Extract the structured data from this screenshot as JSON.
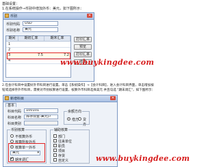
{
  "intro": {
    "heading": "基础设置：",
    "step1_text": "1.在系统操作→币别中增加外币：美元，如下图所示：",
    "step2_line1": "2.在会计科目中设置好外币科目进行设置。单击【系统操作】→【会计科目】，进入会计科目界面，单击增加按",
    "step2_line2": "钮或选择存外币科目，需要对币别核算进行设置，核算外币科目选择美元 并且勾选 \"期末调汇\"，如下图所示："
  },
  "currency_window": {
    "title": "币别",
    "code_label": "币别代码",
    "code_value": "USD",
    "name_label": "币别名称",
    "name_value": "美元",
    "grid_headers": [
      "期间",
      "期初汇率",
      "期末汇率"
    ],
    "rows": [
      {
        "period": "1",
        "rate_begin": "",
        "rate_end": ""
      },
      {
        "period": "2",
        "rate_begin": "",
        "rate_end": ""
      },
      {
        "period": "3",
        "rate_begin": "7.5",
        "rate_end": "7.2"
      },
      {
        "period": "4",
        "rate_begin": "",
        "rate_end": ""
      }
    ],
    "buttons": [
      "打印汇率",
      "预览",
      "打印汇率",
      "增加"
    ]
  },
  "account_window": {
    "title": "新增科目",
    "tabs": [
      "基本"
    ],
    "code_label": "科目代码",
    "code_value": "100101",
    "name_label": "科目名称",
    "name_value": "库存现金-美元户",
    "category_label": "科目类别",
    "balance_group": "余额方向",
    "balance_options": [
      "借方",
      "贷方"
    ],
    "currency_group": "币别核算",
    "currency_options": [
      "不核算外币",
      "核算所有外币",
      "核算单一外币"
    ],
    "currency_selected": "美元",
    "period_adjust_label": "期末调汇",
    "aux_group": "辅助核算",
    "aux_items": [
      "部门",
      "往来单位",
      "职员",
      "项目",
      "存货",
      "自定义"
    ]
  },
  "watermark": "www.buykingdee.com"
}
